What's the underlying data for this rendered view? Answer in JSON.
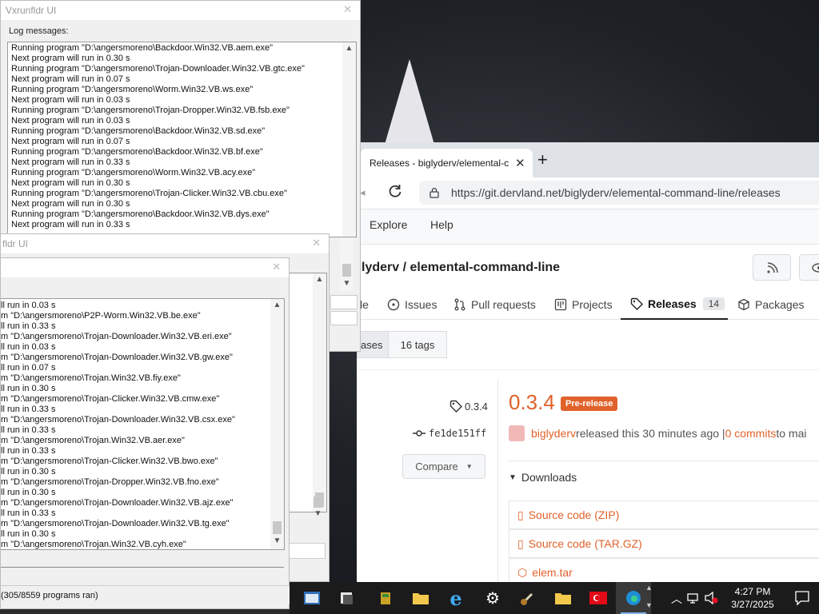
{
  "vx1": {
    "title": "Vxrunfldr UI",
    "log_label": "Log messages:",
    "log_lines": [
      "Running program \"D:\\angersmoreno\\Backdoor.Win32.VB.aem.exe\"",
      "Next program will run in 0.30 s",
      "Running program \"D:\\angersmoreno\\Trojan-Downloader.Win32.VB.gtc.exe\"",
      "Next program will run in 0.07 s",
      "Running program \"D:\\angersmoreno\\Worm.Win32.VB.ws.exe\"",
      "Next program will run in 0.03 s",
      "Running program \"D:\\angersmoreno\\Trojan-Dropper.Win32.VB.fsb.exe\"",
      "Next program will run in 0.03 s",
      "Running program \"D:\\angersmoreno\\Backdoor.Win32.VB.sd.exe\"",
      "Next program will run in 0.07 s",
      "Running program \"D:\\angersmoreno\\Backdoor.Win32.VB.bf.exe\"",
      "Next program will run in 0.33 s",
      "Running program \"D:\\angersmoreno\\Worm.Win32.VB.acy.exe\"",
      "Next program will run in 0.30 s",
      "Running program \"D:\\angersmoreno\\Trojan-Clicker.Win32.VB.cbu.exe\"",
      "Next program will run in 0.30 s",
      "Running program \"D:\\angersmoreno\\Backdoor.Win32.VB.dys.exe\"",
      "Next program will run in 0.33 s"
    ]
  },
  "vx2": {
    "title": "fldr UI"
  },
  "vx3": {
    "log_lines": [
      "ll run in 0.03 s",
      "m \"D:\\angersmoreno\\P2P-Worm.Win32.VB.be.exe\"",
      "ll run in 0.33 s",
      "m \"D:\\angersmoreno\\Trojan-Downloader.Win32.VB.eri.exe\"",
      "ll run in 0.03 s",
      "m \"D:\\angersmoreno\\Trojan-Downloader.Win32.VB.gw.exe\"",
      "ll run in 0.07 s",
      "m \"D:\\angersmoreno\\Trojan.Win32.VB.fiy.exe\"",
      "ll run in 0.30 s",
      "m \"D:\\angersmoreno\\Trojan-Clicker.Win32.VB.cmw.exe\"",
      "ll run in 0.33 s",
      "m \"D:\\angersmoreno\\Trojan-Downloader.Win32.VB.csx.exe\"",
      "ll run in 0.33 s",
      "m \"D:\\angersmoreno\\Trojan.Win32.VB.aer.exe\"",
      "ll run in 0.33 s",
      "m \"D:\\angersmoreno\\Trojan-Clicker.Win32.VB.bwo.exe\"",
      "ll run in 0.30 s",
      "m \"D:\\angersmoreno\\Trojan-Dropper.Win32.VB.fno.exe\"",
      "ll run in 0.30 s",
      "m \"D:\\angersmoreno\\Trojan-Downloader.Win32.VB.ajz.exe\"",
      "ll run in 0.33 s",
      "m \"D:\\angersmoreno\\Trojan-Downloader.Win32.VB.tg.exe\"",
      "ll run in 0.30 s",
      "m \"D:\\angersmoreno\\Trojan.Win32.VB.cyh.exe\""
    ],
    "status": "(305/8559 programs ran)"
  },
  "browser": {
    "tab_title": "Releases - biglyderv/elemental-c",
    "url": "https://git.dervland.net/biglyderv/elemental-command-line/releases",
    "nav": {
      "explore": "Explore",
      "help": "Help"
    },
    "repo_title": "lyderv / elemental-command-line",
    "repo_tabs": {
      "code": "le",
      "issues": "Issues",
      "pulls": "Pull requests",
      "projects": "Projects",
      "releases": "Releases",
      "releases_count": "14",
      "packages": "Packages"
    },
    "segments": {
      "releases": "ases",
      "tags": "16 tags"
    },
    "release": {
      "tag": "0.3.4",
      "commit": "fe1de151ff",
      "compare": "Compare",
      "title": "0.3.4",
      "badge": "Pre-release",
      "author": "biglyderv",
      "released_text": " released this 30 minutes ago | ",
      "commits": "0 commits",
      "to_text": " to mai",
      "downloads_label": "Downloads",
      "downloads": [
        "Source code (ZIP)",
        "Source code (TAR.GZ)",
        "elem.tar"
      ]
    }
  },
  "taskbar": {
    "time": "4:27 PM",
    "date": "3/27/2025"
  }
}
